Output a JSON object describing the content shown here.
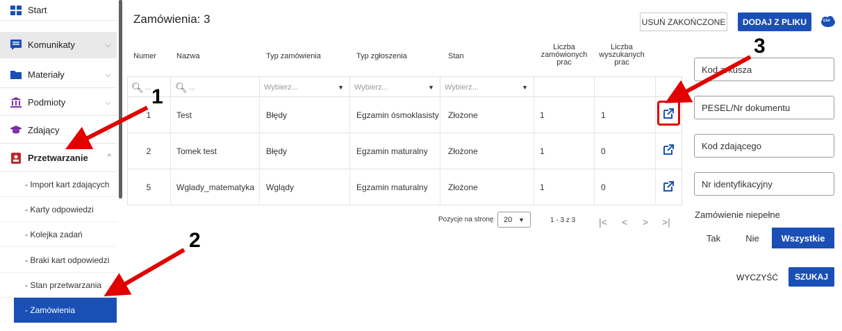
{
  "sidebar": {
    "items": [
      {
        "label": "Start",
        "icon": "dashboard-icon",
        "chevron": ""
      },
      {
        "label": "Komunikaty",
        "icon": "message-icon",
        "chevron": "⌵"
      },
      {
        "label": "Materiały",
        "icon": "folder-icon",
        "chevron": "⌵"
      },
      {
        "label": "Podmioty",
        "icon": "bank-icon",
        "chevron": "⌵"
      },
      {
        "label": "Zdający",
        "icon": "graduation-cap-icon",
        "chevron": "⌵"
      },
      {
        "label": "Przetwarzanie",
        "icon": "id-card-icon",
        "chevron": "^"
      }
    ],
    "subitems": [
      "- Import kart zdających",
      "- Karty odpowiedzi",
      "- Kolejka zadań",
      "- Braki kart odpowiedzi",
      "- Stan przetwarzania",
      "- Zamówienia"
    ]
  },
  "header": {
    "title": "Zamówienia: 3",
    "clear_finished": "USUŃ ZAKOŃCZONE",
    "add_from_file": "DODAJ Z PLIKU",
    "csv_icon_text": "csv"
  },
  "table": {
    "columns": [
      "Numer",
      "Nazwa",
      "Typ zamówienia",
      "Typ zgłoszenia",
      "Stan",
      "Liczba zamówionych prac",
      "Liczba wyszukanych prac"
    ],
    "filters": {
      "search1": "Q...",
      "search2": "Q...",
      "type_placeholder": "Wybierz...",
      "report_placeholder": "Wybierz...",
      "state_placeholder": "Wybierz..."
    },
    "rows": [
      {
        "numer": "1",
        "nazwa": "Test",
        "typ_zamowienia": "Błędy",
        "typ_zgloszenia": "Egzamin ósmoklasisty",
        "stan": "Złożone",
        "zamowionych": "1",
        "wyszukanych": "1"
      },
      {
        "numer": "2",
        "nazwa": "Tomek test",
        "typ_zamowienia": "Błędy",
        "typ_zgloszenia": "Egzamin maturalny",
        "stan": "Złożone",
        "zamowionych": "1",
        "wyszukanych": "0"
      },
      {
        "numer": "5",
        "nazwa": "Wglady_matematyka",
        "typ_zamowienia": "Wglądy",
        "typ_zgloszenia": "Egzamin maturalny",
        "stan": "Złożone",
        "zamowionych": "1",
        "wyszukanych": "0"
      }
    ]
  },
  "pagination": {
    "per_page_label": "Pozycje na stronę",
    "per_page_value": "20",
    "range": "1 - 3 z 3"
  },
  "filters_panel": {
    "sheet_code": "Kod arkusza",
    "pesel": "PESEL/Nr dokumentu",
    "student_code": "Kod zdającego",
    "id_number": "Nr identyfikacyjny",
    "incomplete_label": "Zamówienie niepełne",
    "opt_yes": "Tak",
    "opt_no": "Nie",
    "opt_all": "Wszystkie",
    "clear": "WYCZYŚĆ",
    "search": "SZUKAJ"
  },
  "annotations": [
    "1",
    "2",
    "3"
  ],
  "colors": {
    "accent": "#1a4fb5",
    "arrow": "#e00000"
  }
}
